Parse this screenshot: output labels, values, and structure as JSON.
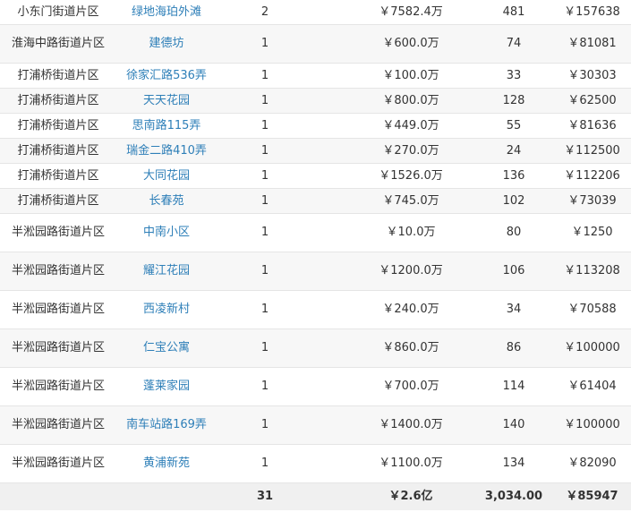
{
  "rows": [
    {
      "district": "小东门街道片区",
      "community": "绿地海珀外滩",
      "count": "2",
      "amount": "￥7582.4万",
      "area": "481",
      "unit_price": "￥157638"
    },
    {
      "district": "淮海中路街道片区",
      "community": "建德坊",
      "count": "1",
      "amount": "￥600.0万",
      "area": "74",
      "unit_price": "￥81081"
    },
    {
      "district": "打浦桥街道片区",
      "community": "徐家汇路536弄",
      "count": "1",
      "amount": "￥100.0万",
      "area": "33",
      "unit_price": "￥30303"
    },
    {
      "district": "打浦桥街道片区",
      "community": "天天花园",
      "count": "1",
      "amount": "￥800.0万",
      "area": "128",
      "unit_price": "￥62500"
    },
    {
      "district": "打浦桥街道片区",
      "community": "思南路115弄",
      "count": "1",
      "amount": "￥449.0万",
      "area": "55",
      "unit_price": "￥81636"
    },
    {
      "district": "打浦桥街道片区",
      "community": "瑞金二路410弄",
      "count": "1",
      "amount": "￥270.0万",
      "area": "24",
      "unit_price": "￥112500"
    },
    {
      "district": "打浦桥街道片区",
      "community": "大同花园",
      "count": "1",
      "amount": "￥1526.0万",
      "area": "136",
      "unit_price": "￥112206"
    },
    {
      "district": "打浦桥街道片区",
      "community": "长春苑",
      "count": "1",
      "amount": "￥745.0万",
      "area": "102",
      "unit_price": "￥73039"
    },
    {
      "district": "半淞园路街道片区",
      "community": "中南小区",
      "count": "1",
      "amount": "￥10.0万",
      "area": "80",
      "unit_price": "￥1250"
    },
    {
      "district": "半淞园路街道片区",
      "community": "耀江花园",
      "count": "1",
      "amount": "￥1200.0万",
      "area": "106",
      "unit_price": "￥113208"
    },
    {
      "district": "半淞园路街道片区",
      "community": "西凌新村",
      "count": "1",
      "amount": "￥240.0万",
      "area": "34",
      "unit_price": "￥70588"
    },
    {
      "district": "半淞园路街道片区",
      "community": "仁宝公寓",
      "count": "1",
      "amount": "￥860.0万",
      "area": "86",
      "unit_price": "￥100000"
    },
    {
      "district": "半淞园路街道片区",
      "community": "蓬莱家园",
      "count": "1",
      "amount": "￥700.0万",
      "area": "114",
      "unit_price": "￥61404"
    },
    {
      "district": "半淞园路街道片区",
      "community": "南车站路169弄",
      "count": "1",
      "amount": "￥1400.0万",
      "area": "140",
      "unit_price": "￥100000"
    },
    {
      "district": "半淞园路街道片区",
      "community": "黄浦新苑",
      "count": "1",
      "amount": "￥1100.0万",
      "area": "134",
      "unit_price": "￥82090"
    }
  ],
  "total": {
    "count": "31",
    "amount": "￥2.6亿",
    "area": "3,034.00",
    "unit_price": "￥85947"
  }
}
